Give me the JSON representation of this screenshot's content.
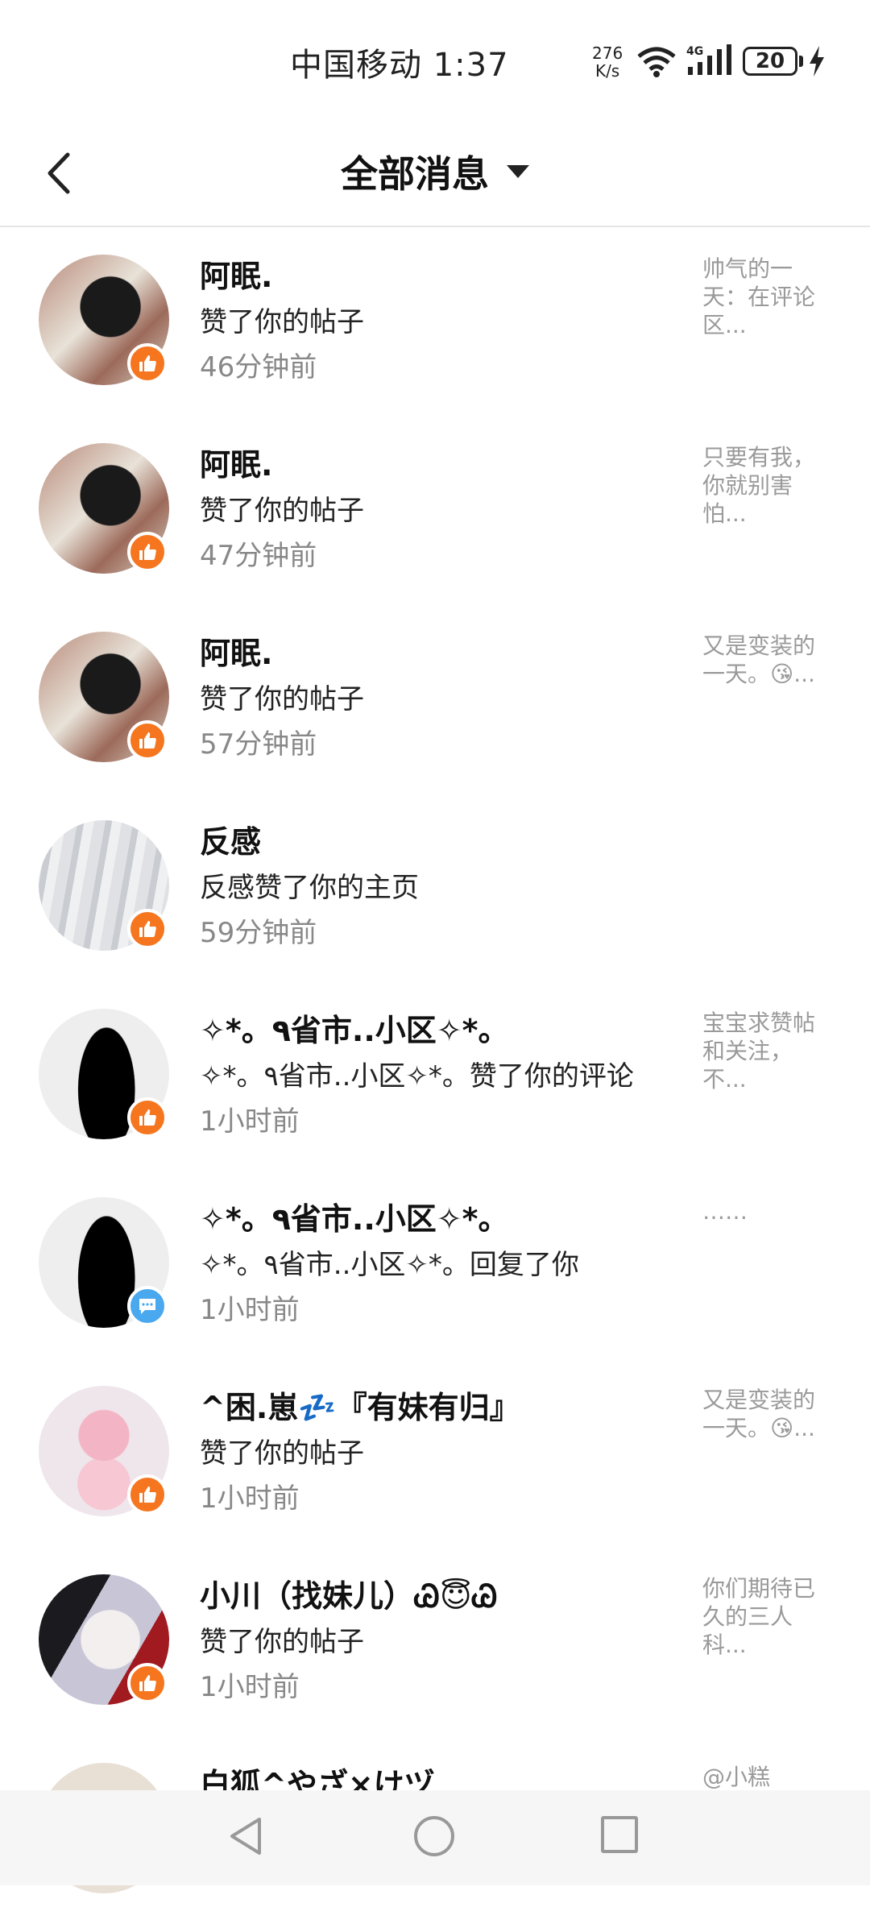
{
  "status_bar": {
    "carrier_time": "中国移动 1:37",
    "speed_value": "276",
    "speed_unit": "K/s",
    "network": "4G",
    "battery": "20"
  },
  "header": {
    "title": "全部消息",
    "back_icon": "chevron-left-icon",
    "dropdown_icon": "caret-down-icon"
  },
  "messages": [
    {
      "name": "阿眠.",
      "action": "赞了你的帖子",
      "time": "46分钟前",
      "preview": "帅气的一天：在评论区...",
      "badge": "like"
    },
    {
      "name": "阿眠.",
      "action": "赞了你的帖子",
      "time": "47分钟前",
      "preview": "只要有我，你就别害怕...",
      "badge": "like"
    },
    {
      "name": "阿眠.",
      "action": "赞了你的帖子",
      "time": "57分钟前",
      "preview": "又是变装的一天。😘...",
      "badge": "like"
    },
    {
      "name": "反感",
      "action": "反感赞了你的主页",
      "time": "59分钟前",
      "preview": "",
      "badge": "like"
    },
    {
      "name": "✧*。٩省市..小区✧*。",
      "action": "✧*。٩省市..小区✧*。赞了你的评论",
      "time": "1小时前",
      "preview": "宝宝求赞帖和关注，不...",
      "badge": "like"
    },
    {
      "name": "✧*。٩省市..小区✧*。",
      "action": "✧*。٩省市..小区✧*。回复了你",
      "time": "1小时前",
      "preview": "……",
      "badge": "reply"
    },
    {
      "name": "^困.崽💤『有妹有归』",
      "action": "赞了你的帖子",
      "time": "1小时前",
      "preview": "又是变装的一天。😘...",
      "badge": "like"
    },
    {
      "name": "小川（找妹儿）Ꮚ😇Ꮚ",
      "action": "赞了你的帖子",
      "time": "1小时前",
      "preview": "你们期待已久的三人科...",
      "badge": "like"
    },
    {
      "name": "白狐^やざ×けヅ",
      "action": "",
      "time": "",
      "preview": "@小糕",
      "badge": ""
    }
  ],
  "colors": {
    "like_badge": "#f5761f",
    "reply_badge": "#4aa8ef",
    "divider": "#e6e6e6"
  },
  "nav_bar": {
    "back_icon": "triangle-back-icon",
    "home_icon": "circle-home-icon",
    "recent_icon": "square-recents-icon"
  }
}
